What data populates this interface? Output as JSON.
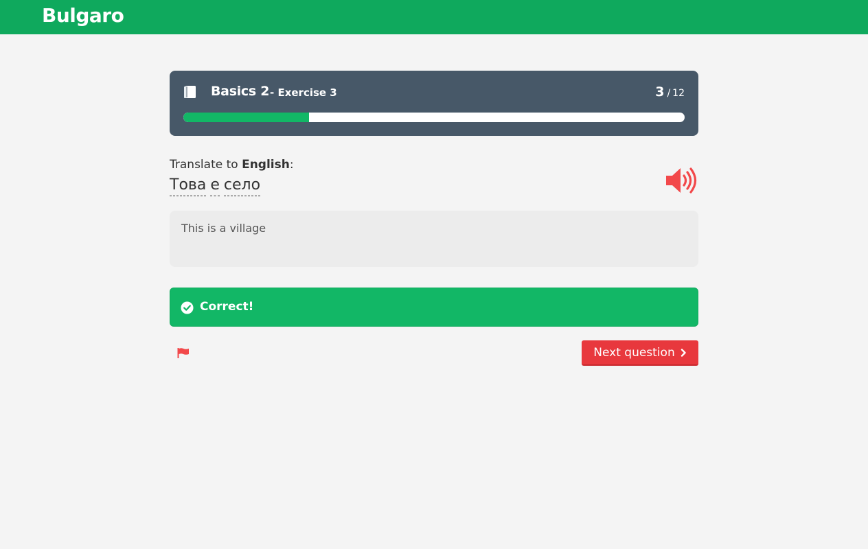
{
  "app": {
    "name": "Bulgaro"
  },
  "lesson": {
    "title": "Basics 2",
    "subtitle": "- Exercise 3",
    "current": "3",
    "separator": "/",
    "total": "12",
    "progress_fraction": 0.25
  },
  "exercise": {
    "prompt_prefix": "Translate to ",
    "prompt_language": "English",
    "prompt_suffix": ":",
    "sentence_words": [
      "Това",
      "е",
      "село"
    ],
    "answer": "This is a village"
  },
  "result": {
    "label": "Correct!"
  },
  "actions": {
    "next_label": "Next question"
  },
  "colors": {
    "brand_green": "#0fa95d",
    "success_green": "#12b766",
    "card_slate": "#475868",
    "accent_red": "#e8383d"
  },
  "icons": {
    "lesson": "book-icon",
    "audio": "speaker-icon",
    "result": "check-circle-icon",
    "report": "flag-icon",
    "next": "chevron-right-icon"
  }
}
